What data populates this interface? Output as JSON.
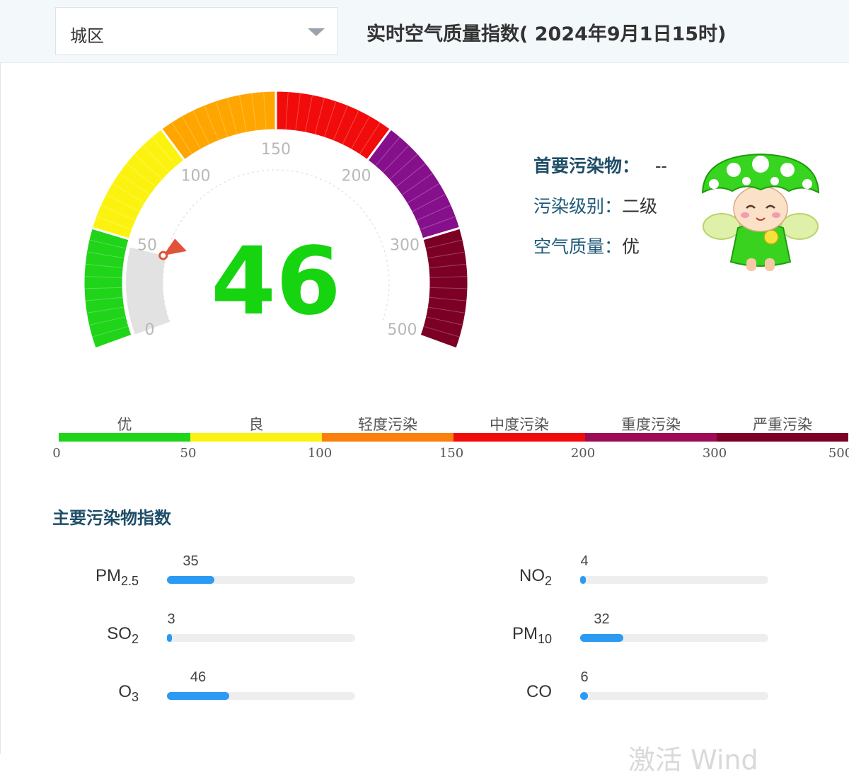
{
  "header": {
    "district_select": {
      "value": "城区"
    },
    "title": "实时空气质量指数( 2024年9月1日15时)"
  },
  "gauge": {
    "aqi_value": "46",
    "aqi_number": 46,
    "aqi_color": "#16d40f",
    "scale_max": 500,
    "ticks": [
      "0",
      "50",
      "100",
      "150",
      "200",
      "300",
      "500"
    ],
    "bands": [
      {
        "from": 0,
        "to": 50,
        "color": "#20d41a"
      },
      {
        "from": 50,
        "to": 100,
        "color": "#fbf30f"
      },
      {
        "from": 100,
        "to": 150,
        "color": "#ffa500"
      },
      {
        "from": 150,
        "to": 200,
        "color": "#f20b0b"
      },
      {
        "from": 200,
        "to": 300,
        "color": "#86108b"
      },
      {
        "from": 300,
        "to": 500,
        "color": "#7c0025"
      }
    ],
    "pointer_color": "#e0533a",
    "inactive_color": "#e2e2e2"
  },
  "info": {
    "primary_pollutant_label": "首要污染物：",
    "primary_pollutant_value": "--",
    "level_label": "污染级别：",
    "level_value": "二级",
    "quality_label": "空气质量：",
    "quality_value": "优"
  },
  "scale_legend": {
    "levels": [
      {
        "name": "优",
        "color": "#20d41a"
      },
      {
        "name": "良",
        "color": "#fbf30f"
      },
      {
        "name": "轻度污染",
        "color": "#fa7f0d"
      },
      {
        "name": "中度污染",
        "color": "#f20b0b"
      },
      {
        "name": "重度污染",
        "color": "#9c0b55"
      },
      {
        "name": "严重污染",
        "color": "#7c0025"
      }
    ],
    "ticks": [
      "0",
      "50",
      "100",
      "150",
      "200",
      "300",
      "500"
    ]
  },
  "pollutants": {
    "title": "主要污染物指数",
    "bar_color": "#2b9af3",
    "track_color": "#eeeeee",
    "items": [
      {
        "base": "PM",
        "sub": "2.5",
        "value": "35",
        "fraction": 0.25
      },
      {
        "base": "NO",
        "sub": "2",
        "value": "4",
        "fraction": 0.03
      },
      {
        "base": "SO",
        "sub": "2",
        "value": "3",
        "fraction": 0.02
      },
      {
        "base": "PM",
        "sub": "10",
        "value": "32",
        "fraction": 0.23
      },
      {
        "base": "O",
        "sub": "3",
        "value": "46",
        "fraction": 0.33
      },
      {
        "base": "CO",
        "sub": "",
        "value": "6",
        "fraction": 0.04
      }
    ]
  },
  "watermark": "激活 Wind"
}
